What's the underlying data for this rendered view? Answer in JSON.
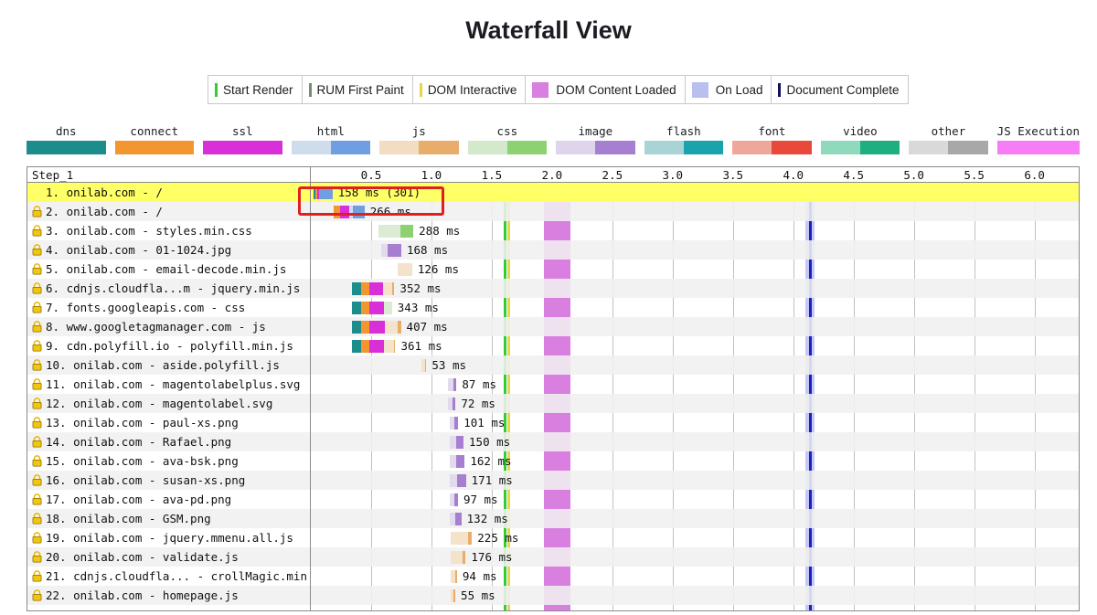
{
  "page_title": "Waterfall View",
  "milestone_legend": [
    {
      "label": "Start Render",
      "color": "#33cc33",
      "style": "line"
    },
    {
      "label": "RUM First Paint",
      "color": "#6f8f6f",
      "style": "line"
    },
    {
      "label": "DOM Interactive",
      "color": "#e8d44d",
      "style": "line"
    },
    {
      "label": "DOM Content Loaded",
      "color": "#d97fe0",
      "style": "box"
    },
    {
      "label": "On Load",
      "color": "#b9c0f0",
      "style": "box"
    },
    {
      "label": "Document Complete",
      "color": "#101060",
      "style": "line"
    }
  ],
  "type_legend": [
    {
      "label": "dns",
      "light": "#1d8c8c",
      "dark": "#1d8c8c"
    },
    {
      "label": "connect",
      "light": "#f2962f",
      "dark": "#f2962f"
    },
    {
      "label": "ssl",
      "light": "#d82fd8",
      "dark": "#d82fd8"
    },
    {
      "label": "html",
      "light": "#cfdcec",
      "dark": "#6f9fe0"
    },
    {
      "label": "js",
      "light": "#f2ddc2",
      "dark": "#e8ad6a"
    },
    {
      "label": "css",
      "light": "#d4e8cb",
      "dark": "#8ed173"
    },
    {
      "label": "image",
      "light": "#ded5ec",
      "dark": "#a77fd1"
    },
    {
      "label": "flash",
      "light": "#a9d4d6",
      "dark": "#1ba3ad"
    },
    {
      "label": "font",
      "light": "#f0a79b",
      "dark": "#e8493a"
    },
    {
      "label": "video",
      "light": "#8fd9bd",
      "dark": "#1fae80"
    },
    {
      "label": "other",
      "light": "#d9d9d9",
      "dark": "#a8a8a8"
    },
    {
      "label": "JS Execution",
      "light": "#f77df7",
      "dark": "#f77df7"
    }
  ],
  "chart_data": {
    "type": "waterfall",
    "step_label": "Step_1",
    "xlabel": "",
    "axis_ticks": [
      "0.5",
      "1.0",
      "1.5",
      "2.0",
      "2.5",
      "3.0",
      "3.5",
      "4.0",
      "4.5",
      "5.0",
      "5.5",
      "6.0"
    ],
    "axis_tick_values": [
      0.5,
      1.0,
      1.5,
      2.0,
      2.5,
      3.0,
      3.5,
      4.0,
      4.5,
      5.0,
      5.5,
      6.0
    ],
    "xlim": [
      0,
      6.2
    ],
    "markers": [
      {
        "name": "Start Render",
        "time": 1.61,
        "color": "#33cc33",
        "style": "thin"
      },
      {
        "name": "DOM Interactive",
        "time": 1.64,
        "color": "#e8d44d",
        "style": "thin"
      },
      {
        "name": "DOM Content Loaded",
        "start": 1.93,
        "end": 2.15,
        "color": "#d97fe0",
        "style": "band"
      },
      {
        "name": "On Load",
        "start": 4.1,
        "end": 4.18,
        "color": "#b9c0f0",
        "style": "onload-band"
      },
      {
        "name": "Document Complete",
        "time": 4.14,
        "color": "#2020c0",
        "style": "thin"
      }
    ],
    "requests": [
      {
        "n": "1.",
        "host": "onilab.com",
        "file": "/",
        "secure": false,
        "highlight": true,
        "start": 0.02,
        "time_label": "158 ms (301)",
        "segments": [
          {
            "type": "dns",
            "w": 0.018
          },
          {
            "type": "connect",
            "w": 0.012
          },
          {
            "type": "ssl",
            "w": 0.016
          },
          {
            "type": "html",
            "w": 0.114
          }
        ]
      },
      {
        "n": "2.",
        "host": "onilab.com",
        "file": "/",
        "secure": true,
        "highlight": false,
        "start": 0.19,
        "time_label": "266 ms",
        "segments": [
          {
            "type": "connect",
            "w": 0.055
          },
          {
            "type": "ssl",
            "w": 0.075
          },
          {
            "type": "html-light",
            "w": 0.03
          },
          {
            "type": "html",
            "w": 0.095
          }
        ]
      },
      {
        "n": "3.",
        "host": "onilab.com",
        "file": "styles.min.css",
        "secure": true,
        "highlight": false,
        "start": 0.56,
        "time_label": "288 ms",
        "segments": [
          {
            "type": "css-light",
            "w": 0.185
          },
          {
            "type": "css",
            "w": 0.105
          }
        ]
      },
      {
        "n": "4.",
        "host": "onilab.com",
        "file": "01-1024.jpg",
        "secure": true,
        "highlight": false,
        "start": 0.58,
        "time_label": "168 ms",
        "segments": [
          {
            "type": "image-light",
            "w": 0.06
          },
          {
            "type": "image",
            "w": 0.11
          }
        ]
      },
      {
        "n": "5.",
        "host": "onilab.com",
        "file": "email-decode.min.js",
        "secure": true,
        "highlight": false,
        "start": 0.72,
        "time_label": "126 ms",
        "segments": [
          {
            "type": "js-light",
            "w": 0.12
          }
        ]
      },
      {
        "n": "6.",
        "host": "cdnjs.cloudfla...m",
        "file": "jquery.min.js",
        "secure": true,
        "highlight": false,
        "start": 0.34,
        "time_label": "352 ms",
        "segments": [
          {
            "type": "dns",
            "w": 0.075
          },
          {
            "type": "connect",
            "w": 0.068
          },
          {
            "type": "ssl",
            "w": 0.118
          },
          {
            "type": "js-light",
            "w": 0.07
          },
          {
            "type": "js",
            "w": 0.022
          }
        ]
      },
      {
        "n": "7.",
        "host": "fonts.googleapis.com",
        "file": "css",
        "secure": true,
        "highlight": false,
        "start": 0.34,
        "time_label": "343 ms",
        "segments": [
          {
            "type": "dns",
            "w": 0.075
          },
          {
            "type": "connect",
            "w": 0.068
          },
          {
            "type": "ssl",
            "w": 0.125
          },
          {
            "type": "css-light",
            "w": 0.065
          }
        ]
      },
      {
        "n": "8.",
        "host": "www.googletagmanager.com",
        "file": "js",
        "secure": true,
        "highlight": false,
        "start": 0.34,
        "time_label": "407 ms",
        "segments": [
          {
            "type": "dns",
            "w": 0.075
          },
          {
            "type": "connect",
            "w": 0.068
          },
          {
            "type": "ssl",
            "w": 0.128
          },
          {
            "type": "js-light",
            "w": 0.112
          },
          {
            "type": "js",
            "w": 0.024
          }
        ]
      },
      {
        "n": "9.",
        "host": "cdn.polyfill.io",
        "file": "polyfill.min.js",
        "secure": true,
        "highlight": false,
        "start": 0.34,
        "time_label": "361 ms",
        "segments": [
          {
            "type": "dns",
            "w": 0.075
          },
          {
            "type": "connect",
            "w": 0.068
          },
          {
            "type": "ssl",
            "w": 0.122
          },
          {
            "type": "js-light",
            "w": 0.082
          },
          {
            "type": "js",
            "w": 0.014
          }
        ]
      },
      {
        "n": "10.",
        "host": "onilab.com",
        "file": "aside.polyfill.js",
        "secure": true,
        "highlight": false,
        "start": 0.92,
        "time_label": "53 ms",
        "segments": [
          {
            "type": "js-light",
            "w": 0.026
          },
          {
            "type": "js",
            "w": 0.012
          }
        ]
      },
      {
        "n": "11.",
        "host": "onilab.com",
        "file": "magentolabelplus.svg",
        "secure": true,
        "highlight": false,
        "start": 1.14,
        "time_label": "87 ms",
        "segments": [
          {
            "type": "image-light",
            "w": 0.04
          },
          {
            "type": "image",
            "w": 0.028
          }
        ]
      },
      {
        "n": "12.",
        "host": "onilab.com",
        "file": "magentolabel.svg",
        "secure": true,
        "highlight": false,
        "start": 1.14,
        "time_label": "72 ms",
        "segments": [
          {
            "type": "image-light",
            "w": 0.036
          },
          {
            "type": "image",
            "w": 0.024
          }
        ]
      },
      {
        "n": "13.",
        "host": "onilab.com",
        "file": "paul-xs.png",
        "secure": true,
        "highlight": false,
        "start": 1.15,
        "time_label": "101 ms",
        "segments": [
          {
            "type": "image-light",
            "w": 0.04
          },
          {
            "type": "image",
            "w": 0.032
          }
        ]
      },
      {
        "n": "14.",
        "host": "onilab.com",
        "file": "Rafael.png",
        "secure": true,
        "highlight": false,
        "start": 1.15,
        "time_label": "150 ms",
        "segments": [
          {
            "type": "image-light",
            "w": 0.058
          },
          {
            "type": "image",
            "w": 0.058
          }
        ]
      },
      {
        "n": "15.",
        "host": "onilab.com",
        "file": "ava-bsk.png",
        "secure": true,
        "highlight": false,
        "start": 1.15,
        "time_label": "162 ms",
        "segments": [
          {
            "type": "image-light",
            "w": 0.056
          },
          {
            "type": "image",
            "w": 0.07
          }
        ]
      },
      {
        "n": "16.",
        "host": "onilab.com",
        "file": "susan-xs.png",
        "secure": true,
        "highlight": false,
        "start": 1.15,
        "time_label": "171 ms",
        "segments": [
          {
            "type": "image-light",
            "w": 0.06
          },
          {
            "type": "image",
            "w": 0.076
          }
        ]
      },
      {
        "n": "17.",
        "host": "onilab.com",
        "file": "ava-pd.png",
        "secure": true,
        "highlight": false,
        "start": 1.15,
        "time_label": "97 ms",
        "segments": [
          {
            "type": "image-light",
            "w": 0.04
          },
          {
            "type": "image",
            "w": 0.03
          }
        ]
      },
      {
        "n": "18.",
        "host": "onilab.com",
        "file": "GSM.png",
        "secure": true,
        "highlight": false,
        "start": 1.15,
        "time_label": "132 ms",
        "segments": [
          {
            "type": "image-light",
            "w": 0.05
          },
          {
            "type": "image",
            "w": 0.048
          }
        ]
      },
      {
        "n": "19.",
        "host": "onilab.com",
        "file": "jquery.mmenu.all.js",
        "secure": true,
        "highlight": false,
        "start": 1.16,
        "time_label": "225 ms",
        "segments": [
          {
            "type": "js-light",
            "w": 0.14
          },
          {
            "type": "js",
            "w": 0.036
          }
        ]
      },
      {
        "n": "20.",
        "host": "onilab.com",
        "file": "validate.js",
        "secure": true,
        "highlight": false,
        "start": 1.16,
        "time_label": "176 ms",
        "segments": [
          {
            "type": "js-light",
            "w": 0.1
          },
          {
            "type": "js",
            "w": 0.024
          }
        ]
      },
      {
        "n": "21.",
        "host": "cdnjs.cloudfla...",
        "file": "crollMagic.min.js",
        "secure": true,
        "highlight": false,
        "start": 1.16,
        "time_label": "94 ms",
        "segments": [
          {
            "type": "js-light",
            "w": 0.036
          },
          {
            "type": "js",
            "w": 0.016
          }
        ]
      },
      {
        "n": "22.",
        "host": "onilab.com",
        "file": "homepage.js",
        "secure": true,
        "highlight": false,
        "start": 1.16,
        "time_label": "55 ms",
        "segments": [
          {
            "type": "js-light",
            "w": 0.026
          },
          {
            "type": "js",
            "w": 0.012
          }
        ]
      }
    ]
  },
  "annotation": {
    "name": "highlight-rectangle",
    "color": "#e02020"
  }
}
